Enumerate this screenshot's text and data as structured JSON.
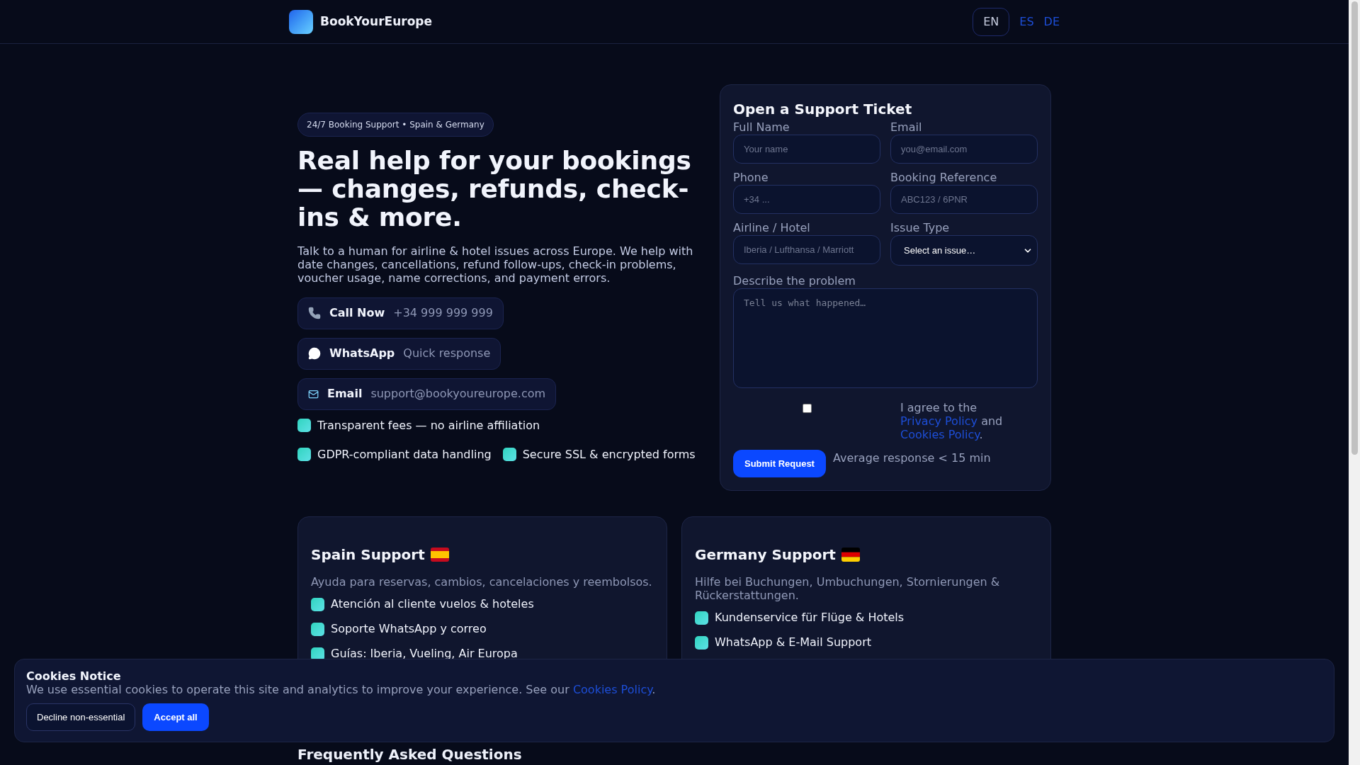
{
  "header": {
    "brand": "BookYourEurope",
    "languages": [
      {
        "label": "EN",
        "selected": true
      },
      {
        "label": "ES",
        "selected": false
      },
      {
        "label": "DE",
        "selected": false
      }
    ]
  },
  "hero": {
    "badge": "24/7 Booking Support • Spain & Germany",
    "title": "Real help for your bookings — changes, refunds, check-ins & more.",
    "intro": "Talk to a human for airline & hotel issues across Europe. We help with date changes, cancellations, refund follow-ups, check-in problems, voucher usage, name corrections, and payment errors.",
    "contacts": [
      {
        "kind": "phone",
        "label": "Call Now",
        "detail": "+34 999 999 999"
      },
      {
        "kind": "chat",
        "label": "WhatsApp",
        "detail": "Quick response"
      },
      {
        "kind": "email",
        "label": "Email",
        "detail": "support@bookyoureurope.com"
      }
    ],
    "features": [
      "Transparent fees — no airline affiliation",
      "GDPR-compliant data handling",
      "Secure SSL & encrypted forms"
    ]
  },
  "form": {
    "title": "Open a Support Ticket",
    "fields": [
      {
        "kind": "input",
        "label": "Full Name",
        "placeholder": "Your name"
      },
      {
        "kind": "input",
        "label": "Email",
        "placeholder": "you@email.com"
      },
      {
        "kind": "input",
        "label": "Phone",
        "placeholder": "+34 ..."
      },
      {
        "kind": "input",
        "label": "Booking Reference",
        "placeholder": "ABC123 / 6PNR"
      },
      {
        "kind": "input",
        "label": "Airline / Hotel",
        "placeholder": "Iberia / Lufthansa / Marriott"
      },
      {
        "kind": "select",
        "label": "Issue Type",
        "value": "Select an issue…"
      }
    ],
    "problem": {
      "label": "Describe the problem",
      "placeholder": "Tell us what happened…"
    },
    "consent": {
      "checked": false,
      "text": "I agree to the ",
      "link_1": "Privacy Policy",
      "middle": " and ",
      "link_2": "Cookies Policy",
      "end": "."
    },
    "submit": "Submit Request",
    "note": "Average response < 15 min"
  },
  "regions": [
    {
      "kind": "es",
      "title": "Spain Support",
      "description": "Ayuda para reservas, cambios, cancelaciones y reembolsos.",
      "items": [
        "Atención al cliente vuelos & hoteles",
        "Soporte WhatsApp y correo",
        "Guías: Iberia, Vueling, Air Europa"
      ]
    },
    {
      "kind": "de",
      "title": "Germany Support",
      "description": "Hilfe bei Buchungen, Umbuchungen, Stornierungen & Rückerstattungen.",
      "items": [
        "Kundenservice für Flüge & Hotels",
        "WhatsApp & E-Mail Support"
      ]
    }
  ],
  "faq": {
    "title": "Frequently Asked Questions"
  },
  "cookies": {
    "title": "Cookies Notice",
    "text": "We use essential cookies to operate this site and analytics to improve your experience. See our ",
    "link": "Cookies Policy",
    "end": ".",
    "buttons": [
      {
        "kind": "secondary",
        "label": "Decline non-essential"
      },
      {
        "kind": "primary",
        "label": "Accept all"
      }
    ]
  }
}
